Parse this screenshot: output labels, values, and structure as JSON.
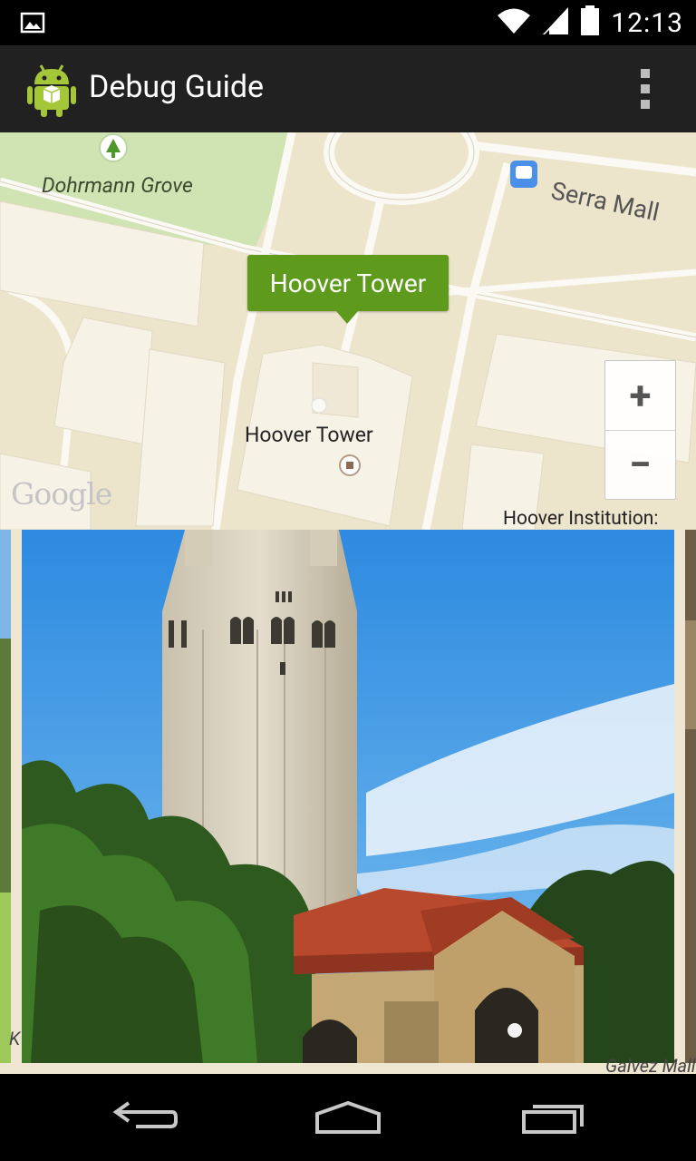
{
  "status_bar": {
    "time": "12:13",
    "icons": [
      "image-notification-icon",
      "wifi-icon",
      "signal-icon",
      "battery-icon"
    ]
  },
  "action_bar": {
    "title": "Debug Guide",
    "app_icon": "android-robot-icon",
    "menu_icon": "overflow-menu-icon"
  },
  "map": {
    "info_window": "Hoover Tower",
    "labels": {
      "grove": "Dohrmann Grove",
      "street": "Serra Mall",
      "tower": "Hoover Tower",
      "institution": "Hoover Institution:",
      "bottom_right": "Galvez Mall",
      "bottom_left": "K"
    },
    "logo": "Google",
    "zoom_in": "+",
    "zoom_out": "−"
  },
  "nav_bar": {
    "icons": [
      "back-icon",
      "home-icon",
      "recent-apps-icon"
    ]
  },
  "colors": {
    "action_bar": "#212121",
    "map_background": "#ede4cc",
    "info_window": "#5e9a1c",
    "park": "#cfe3b3"
  }
}
